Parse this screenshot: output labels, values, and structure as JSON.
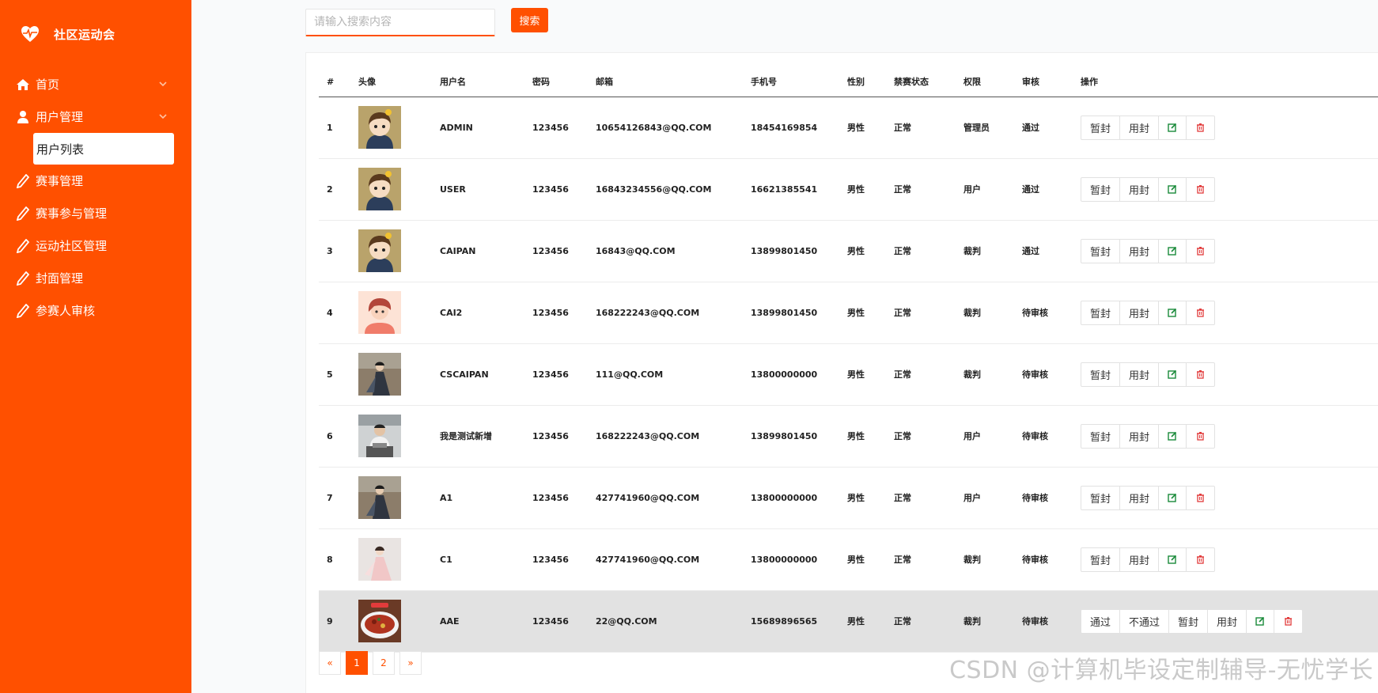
{
  "brand": {
    "name": "社区运动会",
    "icon": "heart-pulse-icon"
  },
  "nav": [
    {
      "label": "首页",
      "icon": "home-icon",
      "expandable": true
    },
    {
      "label": "用户管理",
      "icon": "user-icon",
      "expandable": true,
      "children": [
        {
          "label": "用户列表",
          "active": true
        }
      ]
    },
    {
      "label": "赛事管理",
      "icon": "pen-icon"
    },
    {
      "label": "赛事参与管理",
      "icon": "pen-icon"
    },
    {
      "label": "运动社区管理",
      "icon": "pen-icon"
    },
    {
      "label": "封面管理",
      "icon": "pen-icon"
    },
    {
      "label": "参赛人审核",
      "icon": "pen-icon"
    }
  ],
  "search": {
    "placeholder": "请输入搜索内容",
    "button": "搜索"
  },
  "table": {
    "headers": [
      "#",
      "头像",
      "用户名",
      "密码",
      "邮箱",
      "手机号",
      "性别",
      "禁赛状态",
      "权限",
      "审核",
      "操作"
    ],
    "rows": [
      {
        "id": "1",
        "avatar": "cartoon-boy",
        "username": "ADMIN",
        "password": "123456",
        "email": "10654126843@QQ.COM",
        "phone": "18454169854",
        "gender": "男性",
        "ban": "正常",
        "role": "管理员",
        "review": "通过"
      },
      {
        "id": "2",
        "avatar": "cartoon-boy",
        "username": "USER",
        "password": "123456",
        "email": "16843234556@QQ.COM",
        "phone": "16621385541",
        "gender": "男性",
        "ban": "正常",
        "role": "用户",
        "review": "通过"
      },
      {
        "id": "3",
        "avatar": "cartoon-boy",
        "username": "CAIPAN",
        "password": "123456",
        "email": "16843@QQ.COM",
        "phone": "13899801450",
        "gender": "男性",
        "ban": "正常",
        "role": "裁判",
        "review": "通过"
      },
      {
        "id": "4",
        "avatar": "cartoon-girl",
        "username": "CAI2",
        "password": "123456",
        "email": "168222243@QQ.COM",
        "phone": "13899801450",
        "gender": "男性",
        "ban": "正常",
        "role": "裁判",
        "review": "待审核"
      },
      {
        "id": "5",
        "avatar": "photo-costume-dark",
        "username": "CSCAIPAN",
        "password": "123456",
        "email": "111@QQ.COM",
        "phone": "13800000000",
        "gender": "男性",
        "ban": "正常",
        "role": "裁判",
        "review": "待审核"
      },
      {
        "id": "6",
        "avatar": "photo-laptop-man",
        "username": "我是测试新增",
        "password": "123456",
        "email": "168222243@QQ.COM",
        "phone": "13899801450",
        "gender": "男性",
        "ban": "正常",
        "role": "用户",
        "review": "待审核"
      },
      {
        "id": "7",
        "avatar": "photo-costume-dark",
        "username": "A1",
        "password": "123456",
        "email": "427741960@QQ.COM",
        "phone": "13800000000",
        "gender": "男性",
        "ban": "正常",
        "role": "用户",
        "review": "待审核"
      },
      {
        "id": "8",
        "avatar": "photo-costume-pink",
        "username": "C1",
        "password": "123456",
        "email": "427741960@QQ.COM",
        "phone": "13800000000",
        "gender": "男性",
        "ban": "正常",
        "role": "裁判",
        "review": "待审核"
      },
      {
        "id": "9",
        "avatar": "photo-food-dish",
        "username": "AAE",
        "password": "123456",
        "email": "22@QQ.COM",
        "phone": "15689896565",
        "gender": "男性",
        "ban": "正常",
        "role": "裁判",
        "review": "待审核",
        "highlighted": true
      }
    ],
    "actions": {
      "approve": "通过",
      "reject": "不通过",
      "suspend": "暂封",
      "ban": "用封",
      "edit_icon": "edit-icon",
      "delete_icon": "trash-icon"
    }
  },
  "pagination": {
    "prev": "«",
    "pages": [
      "1",
      "2"
    ],
    "current": "1",
    "next": "»"
  },
  "watermark": "CSDN @计算机毕设定制辅导-无忧学长",
  "colors": {
    "accent": "#ff5000",
    "edit": "#1a8a3a",
    "delete": "#e23b3b",
    "highlight_row": "#e2e2e2"
  }
}
